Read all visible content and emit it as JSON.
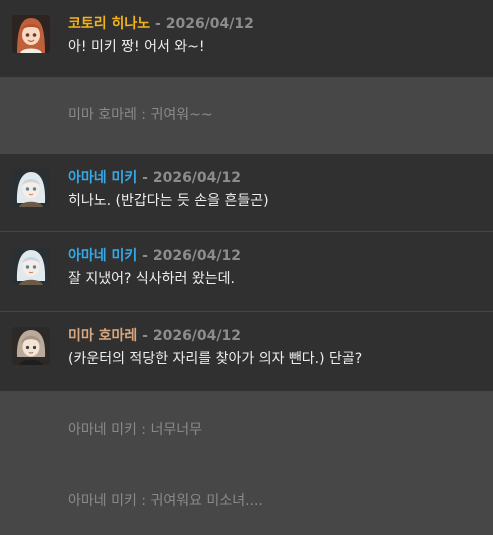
{
  "messages": [
    {
      "kind": "message",
      "avatar_icon": "kotori-hinano-avatar-icon",
      "name": "코토리 히나노",
      "name_color": "#f3b21c",
      "separator": " - ",
      "date": "2026/04/12",
      "text": "아! 미키 짱! 어서 와~!"
    },
    {
      "kind": "whisper",
      "text": "미마 호마레 : 귀여워~~"
    },
    {
      "kind": "message",
      "avatar_icon": "amane-miki-avatar-icon",
      "name": "아마네 미키",
      "name_color": "#35a9e8",
      "separator": " - ",
      "date": "2026/04/12",
      "text": "히나노. (반갑다는 듯 손을 흔들곤)"
    },
    {
      "kind": "message",
      "avatar_icon": "amane-miki-avatar-icon",
      "name": "아마네 미키",
      "name_color": "#35a9e8",
      "separator": " - ",
      "date": "2026/04/12",
      "text": "잘 지냈어? 식사하러 왔는데."
    },
    {
      "kind": "message",
      "avatar_icon": "mima-homare-avatar-icon",
      "name": "미마 호마레",
      "name_color": "#d7a781",
      "separator": " - ",
      "date": "2026/04/12",
      "text": "(카운터의 적당한 자리를 찾아가 의자 뺀다.) 단골?"
    },
    {
      "kind": "whisper",
      "text": "아마네 미키 : 너무너무"
    },
    {
      "kind": "whisper",
      "text": "아마네 미키 : 귀여워요 미소녀...."
    }
  ]
}
